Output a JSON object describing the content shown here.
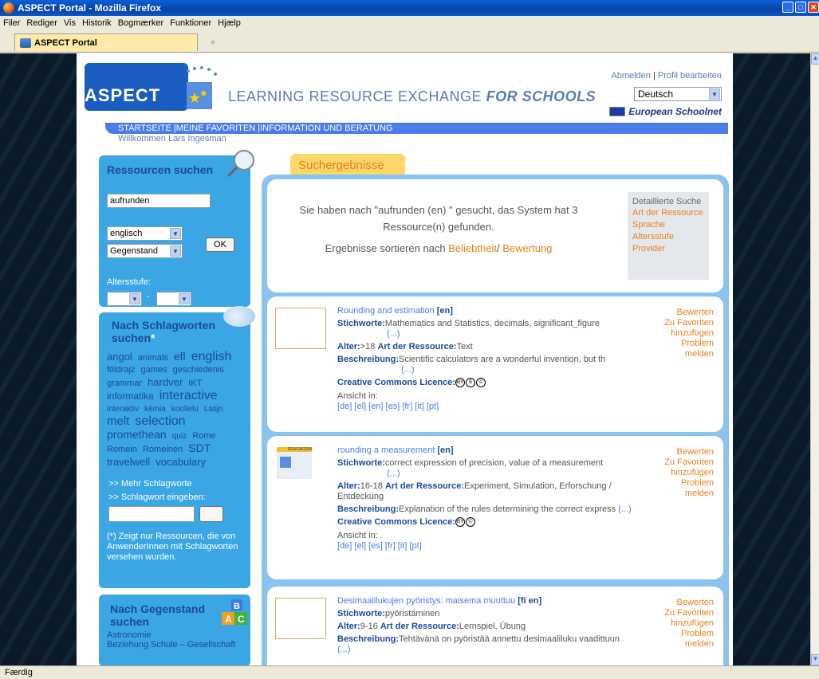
{
  "window": {
    "title": "ASPECT Portal - Mozilla Firefox"
  },
  "menu": [
    "Filer",
    "Rediger",
    "Vis",
    "Historik",
    "Bogmærker",
    "Funktioner",
    "Hjælp"
  ],
  "tab": {
    "label": "ASPECT Portal"
  },
  "header": {
    "logo": "ASPECT",
    "tagline": "LEARNING RESOURCE EXCHANGE",
    "tagline2": "FOR SCHOOLS",
    "logout": "Abmelden",
    "profile": "Profil bearbeiten",
    "language": "Deutsch",
    "partner": "European Schoolnet"
  },
  "nav": {
    "text": "STARTSEITE |MEINE FAVORITEN |INFORMATION UND BERATUNG"
  },
  "welcome": "Willkommen Lars Ingesman",
  "search": {
    "title": "Ressourcen suchen",
    "query": "aufrunden",
    "language": "englisch",
    "field": "Gegenstand",
    "ok": "OK",
    "age_label": "Altersstufe:",
    "age_sep": "-"
  },
  "tagcloud": {
    "title": "Nach Schlagworten suchen",
    "star": "*",
    "more": ">> Mehr Schlagworte",
    "enter": ">> Schlagwort eingeben:",
    "ok": "OK",
    "note": "(*) Zeigt nur Ressourcen, die von AnwenderInnen mit Schlagworten versehen wurden.",
    "tags": [
      [
        "angol",
        "13"
      ],
      [
        "animals",
        "11"
      ],
      [
        "efl",
        "14"
      ],
      [
        "english",
        "16"
      ],
      [
        "földrajz",
        "11"
      ],
      [
        "games",
        "11"
      ],
      [
        "geschiedenis",
        "11"
      ],
      [
        "grammar",
        "11"
      ],
      [
        "hardver",
        "13"
      ],
      [
        "IKT",
        "11"
      ],
      [
        "informatika",
        "12"
      ],
      [
        "interactive",
        "16"
      ],
      [
        "interaktiv",
        "10"
      ],
      [
        "kémia",
        "10"
      ],
      [
        "koolielu",
        "10"
      ],
      [
        "Latijn",
        "10"
      ],
      [
        "melt",
        "15"
      ],
      [
        "selection",
        "16"
      ],
      [
        "promethean",
        "14"
      ],
      [
        "quiz",
        "10"
      ],
      [
        "Rome",
        "11"
      ],
      [
        "Romein",
        "11"
      ],
      [
        "Romeinen",
        "11"
      ],
      [
        "SDT",
        "14"
      ],
      [
        "travelwell",
        "13"
      ],
      [
        "vocabulary",
        "13"
      ]
    ]
  },
  "subject": {
    "title": "Nach Gegenstand suchen",
    "items": [
      "Astronomie",
      "Beziehung Schule – Gesellschaft"
    ]
  },
  "results": {
    "tab": "Suchergebnisse",
    "summary1": "Sie haben nach \"aufrunden (en) \" gesucht, das System hat 3 Ressource(n) gefunden.",
    "sort_label": "Ergebnisse sortieren nach",
    "sort1": "Beliebtheit",
    "sort_sep": "/",
    "sort2": "Bewertung",
    "adv": {
      "title": "Detaillierte Suche",
      "links": [
        "Art der Ressource",
        "Sprache",
        "Altersstufe",
        "Provider"
      ]
    },
    "labels": {
      "keywords": "Stichworte:",
      "age": "Alter:",
      "type": "Art der Ressource:",
      "desc": "Beschreibung:",
      "cc": "Creative Commons Licence:",
      "view": "Ansicht in:",
      "more": "(...)"
    },
    "actions": [
      "Bewerten",
      "Zu Favoriten hinzufügen",
      "Problem melden"
    ],
    "items": [
      {
        "title": "Rounding and estimation",
        "lang": "[en]",
        "keywords": "Mathematics and Statistics, decimals, significant_figure",
        "age": ">18",
        "type": "Text",
        "desc": "Scientific calculators are a wonderful invention, but th",
        "langs": "[de] [el] [en] [es] [fr] [it] [pt]"
      },
      {
        "title": "rounding a measurement",
        "lang": "[en]",
        "keywords": "correct expression of precision, value of a measurement",
        "age": "16-18",
        "type": "Experiment, Simulation, Erforschung / Entdeckung",
        "desc": "Explanation of the rules determining the correct express",
        "langs": "[de] [el] [es] [fr] [it] [pt]",
        "thumb": "EDUCACION"
      },
      {
        "title": "Desimaalilukujen pyöristys: maisema muuttuu",
        "lang": "[fi en]",
        "keywords": "pyöristäminen",
        "age": "9-16",
        "type": "Lernspiel, Übung",
        "desc": "Tehtävänä on pyöristää annettu desimaaliluku vaadittuun"
      }
    ]
  },
  "status": "Færdig"
}
